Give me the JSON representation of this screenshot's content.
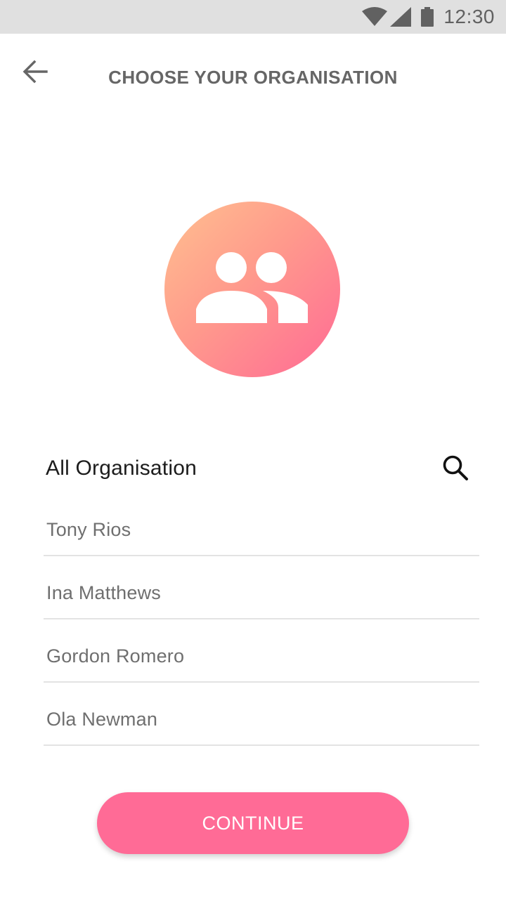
{
  "status_bar": {
    "time": "12:30",
    "icons": [
      "wifi-icon",
      "cell-signal-icon",
      "battery-icon"
    ]
  },
  "header": {
    "title": "CHOOSE YOUR ORGANISATION",
    "back_icon": "arrow-back-icon"
  },
  "avatar": {
    "icon": "group-icon",
    "gradient": [
      "#ffc08f",
      "#ff9a8c",
      "#ff6a95"
    ]
  },
  "organisations": {
    "title": "All Organisation",
    "search_icon": "search-icon",
    "items": [
      {
        "label": "Tony Rios"
      },
      {
        "label": "Ina Matthews"
      },
      {
        "label": "Gordon Romero"
      },
      {
        "label": "Ola Newman"
      }
    ]
  },
  "actions": {
    "continue_label": "CONTINUE"
  },
  "colors": {
    "accent": "#ff6b96",
    "title_text": "#666666",
    "item_text": "#6f6f6f",
    "divider": "#e3e3e3",
    "status_bar_bg": "#e0e0e0"
  }
}
